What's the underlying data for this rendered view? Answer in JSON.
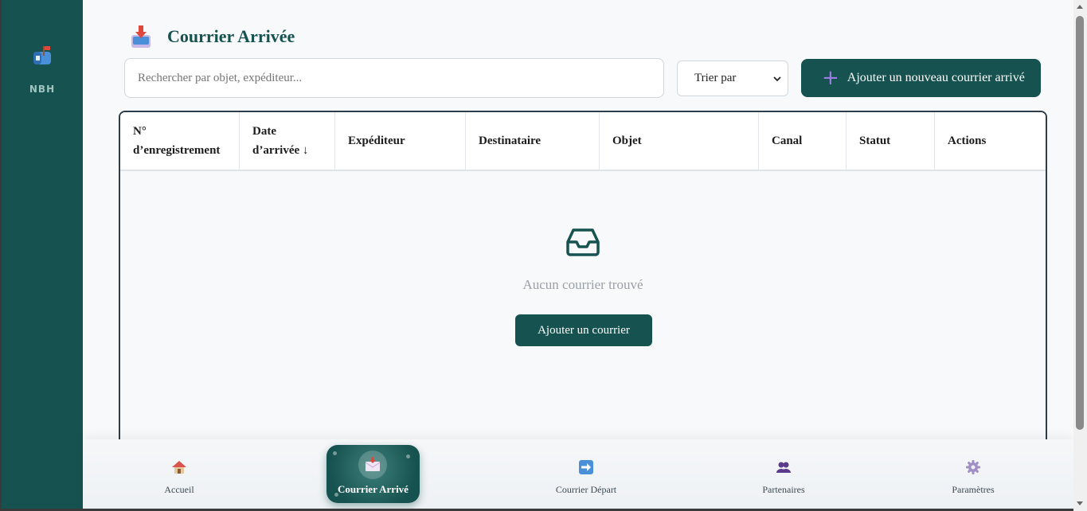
{
  "sidebar": {
    "brand": "NBH",
    "logo_icon": "mailbox-icon"
  },
  "header": {
    "title": "Courrier Arrivée",
    "icon": "inbox-tray-icon"
  },
  "search": {
    "placeholder": "Rechercher par objet, expéditeur..."
  },
  "sort": {
    "selected": "Trier par"
  },
  "add_button": {
    "label": "Ajouter un nouveau courrier arrivé",
    "icon": "plus-icon"
  },
  "table": {
    "columns": [
      {
        "l1": "N°",
        "l2": "d’enregistrement"
      },
      {
        "l1": "Date",
        "l2": "d’arrivée ↓"
      },
      {
        "l1": "Expéditeur",
        "l2": ""
      },
      {
        "l1": "Destinataire",
        "l2": ""
      },
      {
        "l1": "Objet",
        "l2": ""
      },
      {
        "l1": "Canal",
        "l2": ""
      },
      {
        "l1": "Statut",
        "l2": ""
      },
      {
        "l1": "Actions",
        "l2": ""
      }
    ],
    "empty_message": "Aucun courrier trouvé",
    "empty_button": "Ajouter un courrier"
  },
  "bottom_nav": [
    {
      "label": "Accueil",
      "icon": "house-icon"
    },
    {
      "label": "Courrier Arrivé",
      "icon": "incoming-envelope-icon",
      "active": true
    },
    {
      "label": "Courrier Départ",
      "icon": "right-arrow-icon"
    },
    {
      "label": "Partenaires",
      "icon": "people-icon"
    },
    {
      "label": "Paramètres",
      "icon": "gear-icon"
    }
  ],
  "colors": {
    "primary": "#16524f",
    "accent": "#9b7be6",
    "background": "#f7f9fb"
  }
}
